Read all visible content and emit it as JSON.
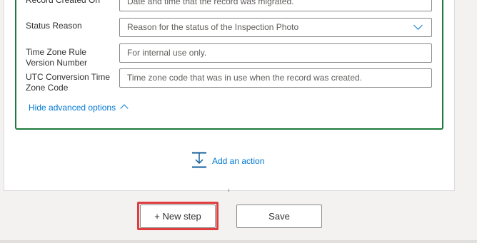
{
  "form": {
    "rows": [
      {
        "label": "Record Created On",
        "value": "Date and time that the record was migrated.",
        "type": "text"
      },
      {
        "label": "Status Reason",
        "value": "Reason for the status of the Inspection Photo",
        "type": "select"
      },
      {
        "label": "Time Zone Rule Version Number",
        "value": "For internal use only.",
        "type": "text"
      },
      {
        "label": "UTC Conversion Time Zone Code",
        "value": "Time zone code that was in use when the record was created.",
        "type": "text"
      }
    ],
    "hide_advanced_label": "Hide advanced options"
  },
  "add_action": {
    "label": "Add an action"
  },
  "footer": {
    "new_step_label": "+ New step",
    "save_label": "Save"
  },
  "colors": {
    "accent": "#0078d4",
    "action_border": "#1e7a3c",
    "highlight": "#e03e3e"
  }
}
